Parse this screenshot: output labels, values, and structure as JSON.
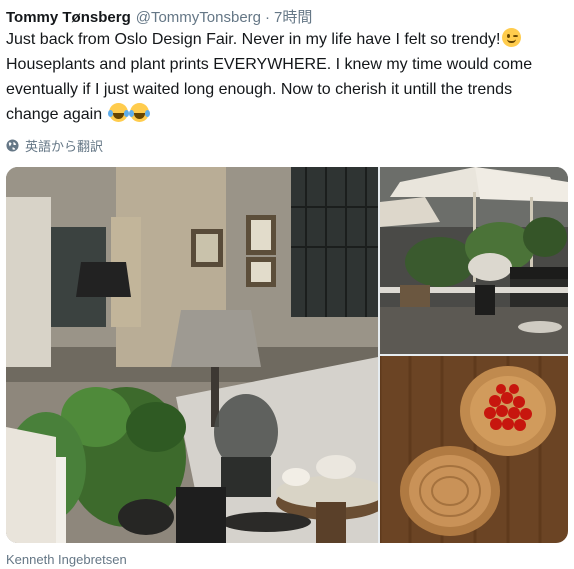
{
  "tweet": {
    "author_name": "Tommy Tønsberg",
    "handle": "@TommyTonsberg",
    "separator": "·",
    "time": "7時間",
    "text_part1": "Just back from Oslo Design Fair. Never in my life have I felt so trendy!",
    "text_part2": " Houseplants and plant prints EVERYWHERE. I knew my time would come eventually if I just waited long enough. Now to cherish it untill the trends change again ",
    "emoji_1": "winking-face",
    "emoji_2": "face-with-tears-of-joy",
    "emoji_3": "face-with-tears-of-joy"
  },
  "translate": {
    "label": "英語から翻訳",
    "icon": "globe-icon"
  },
  "media": {
    "images": [
      {
        "name": "showroom-interior-photo"
      },
      {
        "name": "parasol-garden-display-photo"
      },
      {
        "name": "wooden-bowls-photo"
      }
    ]
  },
  "credit": "Kenneth Ingebretsen",
  "colors": {
    "text": "#14171a",
    "secondary": "#657786",
    "emoji_yellow": "#ffcc4d"
  }
}
